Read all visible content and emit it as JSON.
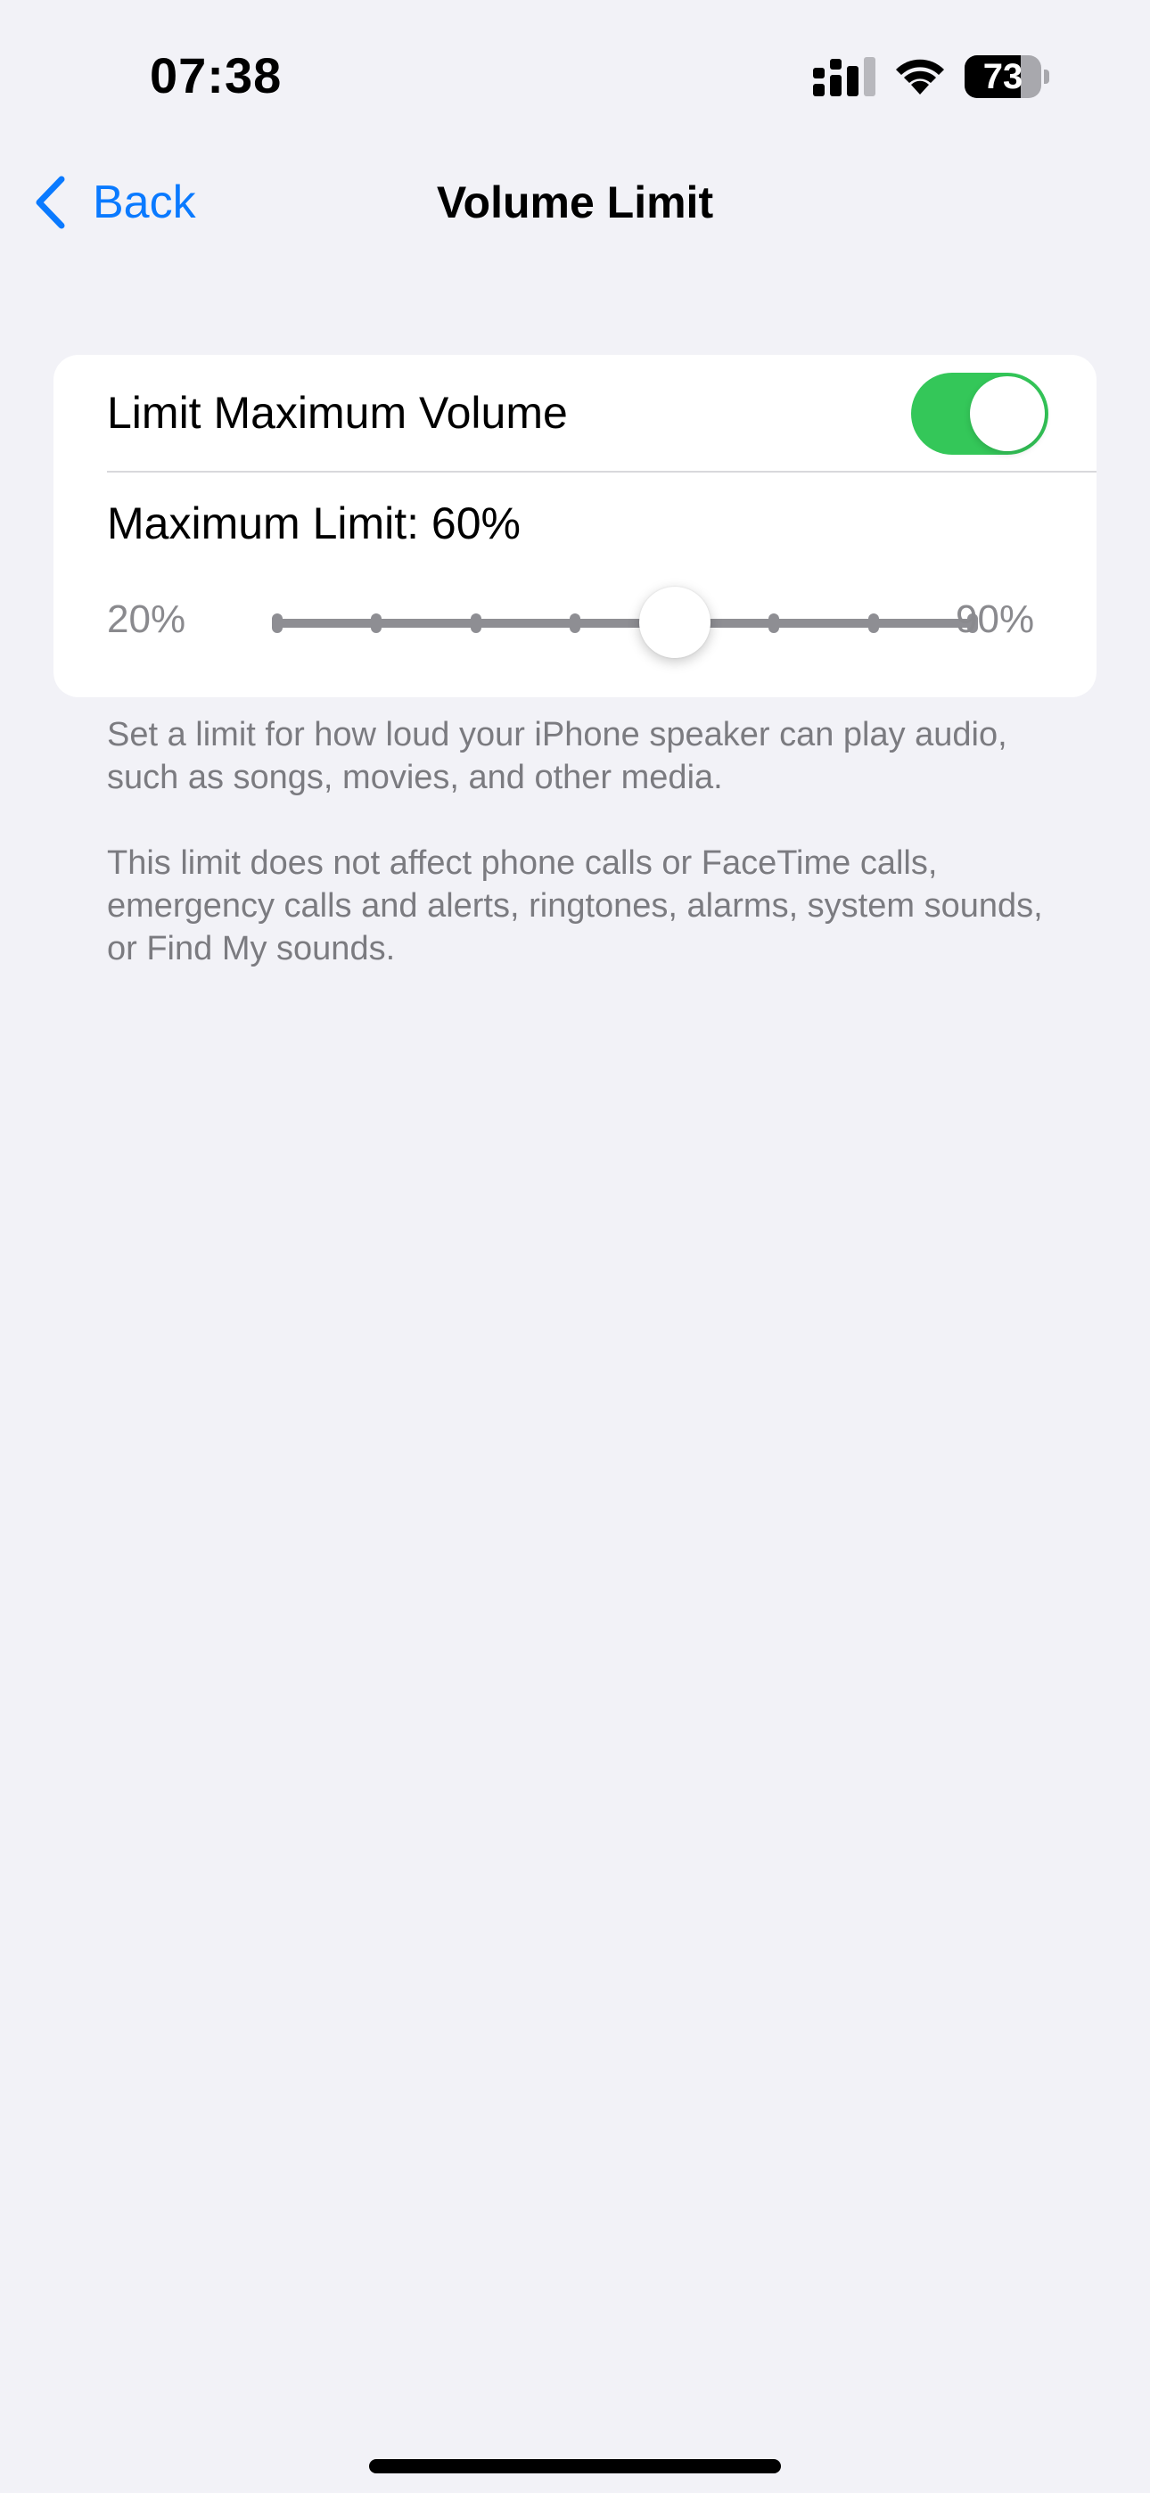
{
  "status_bar": {
    "time": "07:38",
    "battery_level": "73",
    "icons": [
      "signal-icon",
      "wifi-icon",
      "battery-icon"
    ]
  },
  "nav": {
    "back_label": "Back",
    "title": "Volume Limit",
    "accent_color": "#0a7aff"
  },
  "toggle_row": {
    "label": "Limit Maximum Volume",
    "on": true,
    "on_color": "#34c759"
  },
  "limit_slider": {
    "label": "Maximum Limit: 60%",
    "min_label": "20%",
    "max_label": "90%",
    "min": 20,
    "max": 90,
    "step": 10,
    "value": 60
  },
  "footer": {
    "note_1": "Set a limit for how loud your iPhone speaker can play audio, such as songs, movies, and other media.",
    "note_2": "This limit does not affect phone calls or FaceTime calls, emergency calls and alerts, ringtones, alarms, system sounds, or Find My sounds."
  }
}
